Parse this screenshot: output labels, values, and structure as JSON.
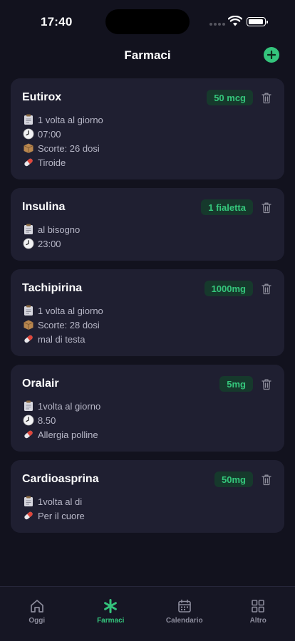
{
  "status_bar": {
    "time": "17:40"
  },
  "header": {
    "title": "Farmaci"
  },
  "medications": [
    {
      "name": "Eutirox",
      "dose": "50 mcg",
      "details": [
        {
          "icon": "clipboard-icon",
          "text": "1 volta al giorno"
        },
        {
          "icon": "clock-icon",
          "text": "07:00"
        },
        {
          "icon": "box-icon",
          "text": "Scorte: 26 dosi"
        },
        {
          "icon": "pill-icon",
          "text": "Tiroide"
        }
      ]
    },
    {
      "name": "Insulina",
      "dose": "1 fialetta",
      "details": [
        {
          "icon": "clipboard-icon",
          "text": "al bisogno"
        },
        {
          "icon": "clock-icon",
          "text": "23:00"
        }
      ]
    },
    {
      "name": "Tachipirina",
      "dose": "1000mg",
      "details": [
        {
          "icon": "clipboard-icon",
          "text": "1 volta al giorno"
        },
        {
          "icon": "box-icon",
          "text": "Scorte: 28 dosi"
        },
        {
          "icon": "pill-icon",
          "text": "mal di testa"
        }
      ]
    },
    {
      "name": "Oralair",
      "dose": "5mg",
      "details": [
        {
          "icon": "clipboard-icon",
          "text": "1volta al giorno"
        },
        {
          "icon": "clock-icon",
          "text": "8.50"
        },
        {
          "icon": "pill-icon",
          "text": "Allergia polline"
        }
      ]
    },
    {
      "name": "Cardioasprina",
      "dose": "50mg",
      "details": [
        {
          "icon": "clipboard-icon",
          "text": "1volta al di"
        },
        {
          "icon": "pill-icon",
          "text": "Per il cuore"
        }
      ]
    }
  ],
  "tabs": [
    {
      "label": "Oggi",
      "icon": "home-icon",
      "active": false
    },
    {
      "label": "Farmaci",
      "icon": "asterisk-icon",
      "active": true
    },
    {
      "label": "Calendario",
      "icon": "calendar-icon",
      "active": false
    },
    {
      "label": "Altro",
      "icon": "grid-icon",
      "active": false
    }
  ],
  "colors": {
    "accent": "#34c47c",
    "background": "#12121e",
    "card": "#1f1f31",
    "badge_bg": "#16392c"
  }
}
